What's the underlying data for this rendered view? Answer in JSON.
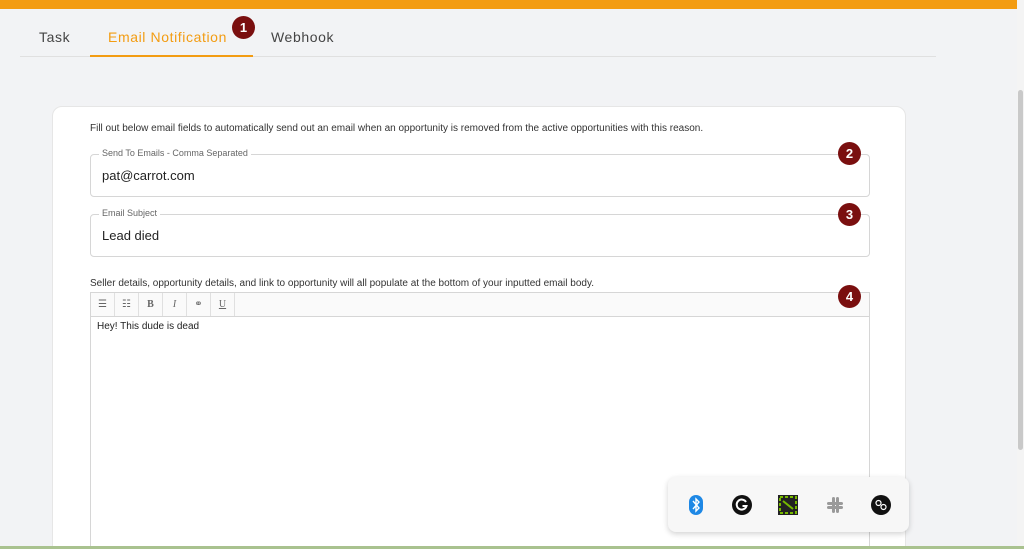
{
  "tabs": [
    {
      "label": "Task"
    },
    {
      "label": "Email Notification"
    },
    {
      "label": "Webhook"
    }
  ],
  "active_tab": "Email Notification",
  "colors": {
    "accent": "#f39c12",
    "badge": "#7a0f0f"
  },
  "badges": [
    "1",
    "2",
    "3",
    "4"
  ],
  "form": {
    "intro": "Fill out below email fields to automatically send out an email when an opportunity is removed from the active opportunities with this reason.",
    "send_to": {
      "label": "Send To Emails - Comma Separated",
      "value": "pat@carrot.com"
    },
    "subject": {
      "label": "Email Subject",
      "value": "Lead died"
    },
    "body_label": "Seller details, opportunity details, and link to opportunity will all populate at the bottom of your inputted email body.",
    "toolbar": [
      {
        "icon": "bulleted-list-icon",
        "glyph": "☰"
      },
      {
        "icon": "numbered-list-icon",
        "glyph": "☷"
      },
      {
        "icon": "bold-icon",
        "glyph": "B"
      },
      {
        "icon": "italic-icon",
        "glyph": "I"
      },
      {
        "icon": "link-icon",
        "glyph": "⚭"
      },
      {
        "icon": "underline-icon",
        "glyph": "U"
      }
    ],
    "body_text": "Hey! This dude is dead"
  },
  "system_tray": [
    "bluetooth-icon",
    "grammarly-icon",
    "nvidia-icon",
    "slack-icon",
    "bang-olufsen-icon"
  ]
}
